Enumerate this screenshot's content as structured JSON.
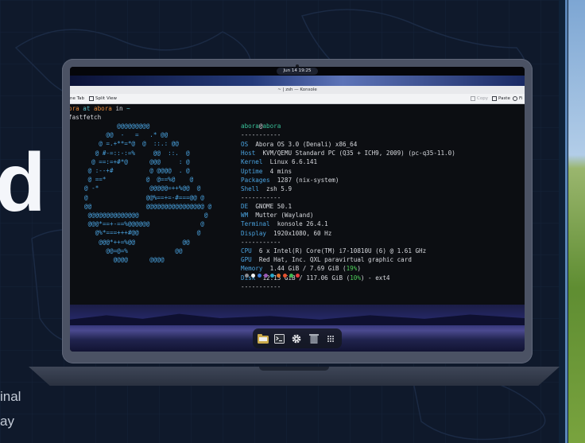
{
  "hero": {
    "big_letter": "d",
    "line1": "inal",
    "line2": "ay"
  },
  "desktop": {
    "clock": "Jun 14  19:25"
  },
  "window": {
    "title": "~ | zsh — Konsole",
    "toolbar": {
      "new_tab": "ne Tab",
      "split_view": "Split View",
      "copy": "Copy",
      "paste": "Paste",
      "find": "Fi"
    }
  },
  "terminal": {
    "prompt_user": "ora",
    "prompt_at": " at ",
    "prompt_host": "abora",
    "prompt_in": " in ",
    "prompt_dir": "~",
    "command": "fastfetch",
    "logo_lines": [
      "         @@@@@@@@@",
      "      @@  -   =   .* @@",
      "    @ =.+**=*@  @  ::.: @@",
      "   @ #-=::-:=%     @@  ::.  @",
      "  @ ==:=+#*@      @@@     : @",
      " @ :--+#          @ @@@@  . @",
      " @ ==*           @  @==%@    @",
      "@ -*              @@@@@=++%@@  @",
      "@                @@%==+=-#===@@ @",
      "@@               @@@@@@@@@@@@@@@@ @",
      " @@@@@@@@@@@@@@                  @",
      " @@@*==+-==%@@@@@@              @",
      "   @%*===+++#@@                @",
      "    @@@*++=%@@             @@",
      "      @@=@=%             @@",
      "        @@@@      @@@@"
    ],
    "user": "abora",
    "at": "@",
    "host": "abora",
    "separator": "-----------",
    "info": [
      {
        "label": "OS",
        "value": "Abora OS 3.0 (Denali) x86_64"
      },
      {
        "label": "Host",
        "value": "KVM/QEMU Standard PC (Q35 + ICH9, 2009) (pc-q35-11.0)"
      },
      {
        "label": "Kernel",
        "value": "Linux 6.6.141"
      },
      {
        "label": "Uptime",
        "value": "4 mins"
      },
      {
        "label": "Packages",
        "value": "1287 (nix-system)"
      },
      {
        "label": "Shell",
        "value": "zsh 5.9"
      }
    ],
    "info2": [
      {
        "label": "DE",
        "value": "GNOME 50.1"
      },
      {
        "label": "WM",
        "value": "Mutter (Wayland)"
      },
      {
        "label": "Terminal",
        "value": "konsole 26.4.1"
      },
      {
        "label": "Display",
        "value": "1920x1080, 60 Hz"
      }
    ],
    "info3": [
      {
        "label": "CPU",
        "value": "6 x Intel(R) Core(TM) i7-10810U (6) @ 1.61 GHz"
      },
      {
        "label": "GPU",
        "value": "Red Hat, Inc. QXL paravirtual graphic card"
      },
      {
        "label": "Memory",
        "value_a": "1.44 GiB / 7.69 GiB (",
        "pct": "19%",
        "value_b": ")"
      },
      {
        "label": "Disk",
        "value_a": "12.13 GiB / 117.06 GiB (",
        "pct": "10%",
        "value_b": ") - ext4"
      }
    ],
    "palette": [
      "#8a8d94",
      "#f2f2f2",
      "#3a7bd5",
      "#9b59b6",
      "#2aa7c9",
      "#e0702b",
      "#e8532f",
      "#3fb950",
      "#e33b3b"
    ]
  },
  "dock": {
    "icons": [
      "files-icon",
      "terminal-icon",
      "settings-gear-icon",
      "trash-icon",
      "app-grid-icon"
    ]
  }
}
